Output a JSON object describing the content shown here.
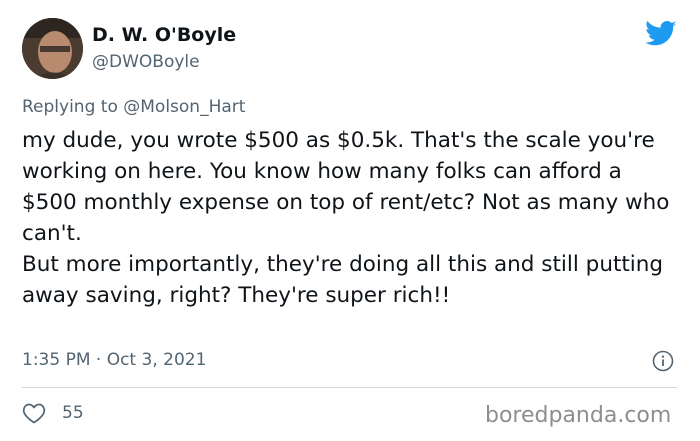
{
  "author": {
    "display_name": "D. W. O'Boyle",
    "handle": "@DWOBoyle"
  },
  "reply": {
    "prefix": "Replying to",
    "mention": "@Molson_Hart"
  },
  "tweet": {
    "paragraph_1": "my dude, you wrote $500 as $0.5k. That's the scale you're working on here. You know how many folks can afford a $500 monthly expense on top of rent/etc? Not as many who can't.",
    "paragraph_2": "But more importantly, they're doing all this and still putting away saving, right? They're super rich!!"
  },
  "meta": {
    "timestamp": "1:35 PM · Oct 3, 2021"
  },
  "actions": {
    "like_count": "55"
  },
  "watermark": "boredpanda.com",
  "colors": {
    "twitter_blue": "#1d9bf0",
    "secondary_text": "#536471",
    "primary_text": "#0f1419"
  },
  "icons": [
    "twitter-bird-icon",
    "info-icon",
    "heart-icon"
  ]
}
